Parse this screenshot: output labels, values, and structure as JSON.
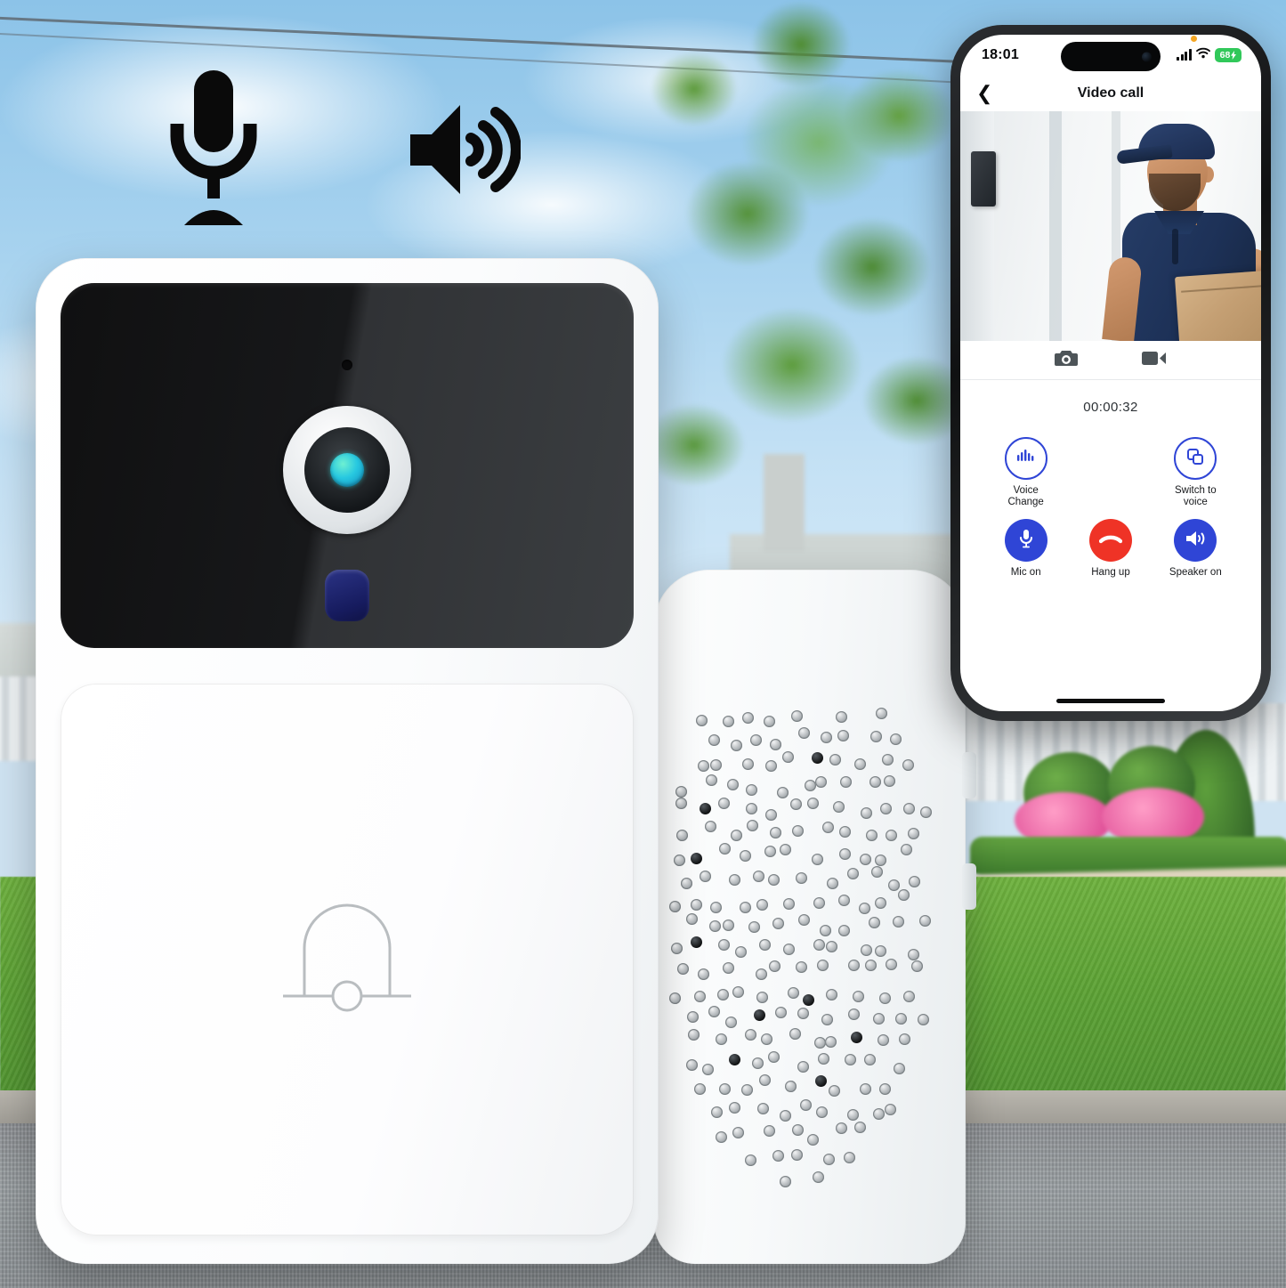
{
  "product": {
    "features": [
      {
        "icon": "microphone-icon",
        "name": "two-way-audio-microphone"
      },
      {
        "icon": "speaker-icon",
        "name": "two-way-audio-speaker"
      }
    ],
    "doorbell": {
      "camera_panel": "camera-panel",
      "lens": "camera-lens",
      "mic_pinhole": "pinhole-microphone",
      "pir_sensor": "pir-motion-sensor",
      "button_icon": "bell-icon"
    },
    "chime": {
      "name": "wireless-chime-receiver",
      "grille": "speaker-grille"
    }
  },
  "phone": {
    "statusbar": {
      "time": "18:01",
      "signal_icon": "cellular-signal-icon",
      "wifi_icon": "wifi-icon",
      "battery_level": "68",
      "battery_icon": "battery-charging-icon",
      "recording_dot": "orange-privacy-dot"
    },
    "navbar": {
      "back_icon": "chevron-left-icon",
      "title": "Video call"
    },
    "video_feed": {
      "name": "live-video-feed",
      "subject": "delivery-person-with-package"
    },
    "media_actions": [
      {
        "icon": "camera-icon",
        "name": "snapshot-button"
      },
      {
        "icon": "video-camera-icon",
        "name": "record-button"
      }
    ],
    "timer": "00:00:32",
    "controls": [
      {
        "label": "Voice\nChange",
        "label_lines": [
          "Voice",
          "Change"
        ],
        "icon": "voice-waveform-icon",
        "style": "outline",
        "name": "voice-change-button"
      },
      {
        "label": "",
        "label_lines": [],
        "icon": "",
        "style": "empty",
        "name": "spacer"
      },
      {
        "label": "Switch to voice",
        "label_lines": [
          "Switch to",
          "voice"
        ],
        "icon": "switch-windows-icon",
        "style": "outline",
        "name": "switch-to-voice-button"
      },
      {
        "label": "Mic on",
        "label_lines": [
          "Mic on"
        ],
        "icon": "microphone-icon",
        "style": "filled-blue",
        "name": "mic-toggle-button"
      },
      {
        "label": "Hang up",
        "label_lines": [
          "Hang up"
        ],
        "icon": "phone-hangup-icon",
        "style": "filled-red",
        "name": "hang-up-button"
      },
      {
        "label": "Speaker on",
        "label_lines": [
          "Speaker on"
        ],
        "icon": "speaker-icon",
        "style": "filled-blue",
        "name": "speaker-toggle-button"
      }
    ],
    "home_indicator": "home-indicator"
  },
  "colors": {
    "accent_blue": "#2f45d6",
    "danger_red": "#ef3326",
    "battery_green": "#31c85a"
  }
}
